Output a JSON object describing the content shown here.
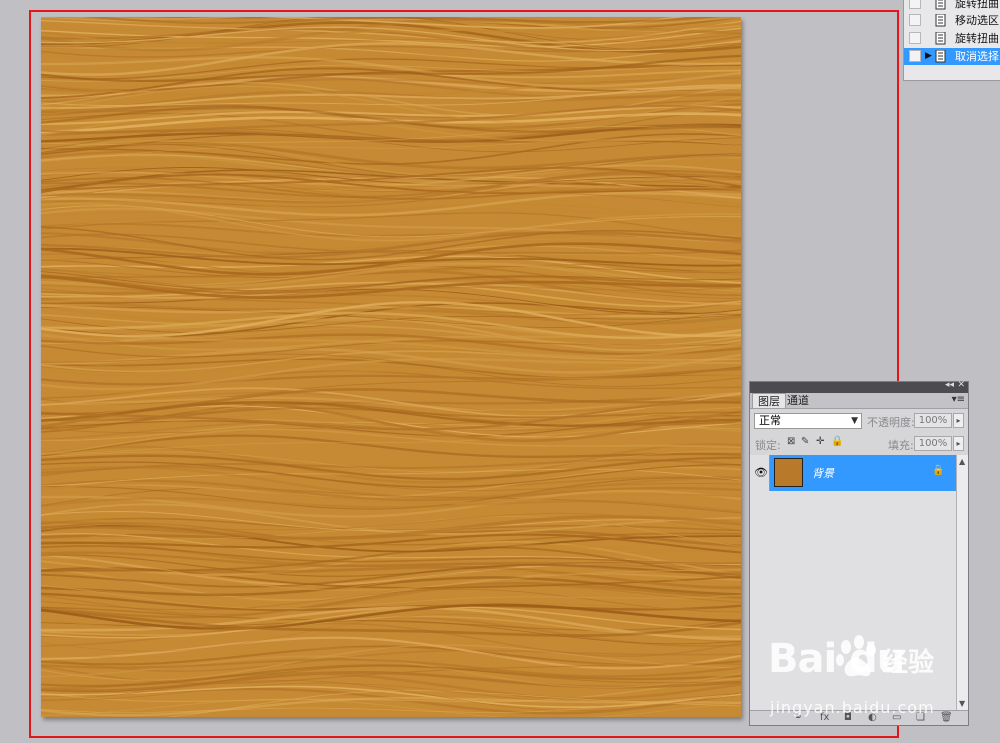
{
  "history": {
    "items": [
      {
        "label": "旋转扭曲",
        "active": false
      },
      {
        "label": "移动选区",
        "active": false
      },
      {
        "label": "旋转扭曲",
        "active": false
      },
      {
        "label": "取消选择",
        "active": true
      }
    ]
  },
  "layers_panel": {
    "tabs": [
      "图层",
      "通道"
    ],
    "blend_mode": "正常",
    "opacity_label": "不透明度:",
    "opacity_value": "100%",
    "lock_label": "锁定:",
    "fill_label": "填充:",
    "fill_value": "100%",
    "layers": [
      {
        "name": "背景",
        "visible": true,
        "locked": true,
        "selected": true
      }
    ]
  },
  "watermark": {
    "logo": "Bai du",
    "text": "经验",
    "url": "jingyan.baidu.com"
  },
  "colors": {
    "canvas_background": "#c0bfc4",
    "wood_base": "#c58a33",
    "selection_blue": "#3399ff",
    "annotation_red": "#e4161b"
  }
}
